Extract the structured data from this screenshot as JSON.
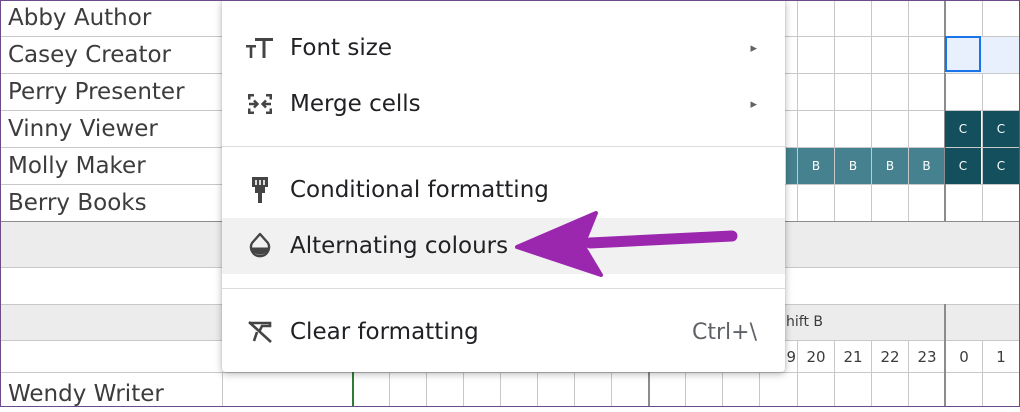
{
  "sheet": {
    "names": [
      "Abby Author",
      "Casey Creator",
      "Perry Presenter",
      "Vinny Viewer",
      "Molly Maker",
      "Berry Books"
    ],
    "bottom_name": "Wendy Writer",
    "shift_label": "hift B",
    "hours": [
      "9",
      "20",
      "21",
      "22",
      "23",
      "0",
      "1"
    ],
    "shift_codes": {
      "b": "B",
      "c": "C"
    },
    "colors": {
      "shift_b": "#45818e",
      "shift_c": "#134f5c",
      "selection": "#1a73e8"
    }
  },
  "menu": {
    "items": [
      {
        "label": "Font size",
        "icon": "font-size-icon",
        "submenu": "▸"
      },
      {
        "label": "Merge cells",
        "icon": "merge-cells-icon",
        "submenu": "▸"
      },
      {
        "label": "Conditional formatting",
        "icon": "paint-roller-icon"
      },
      {
        "label": "Alternating colours",
        "icon": "droplet-icon"
      },
      {
        "label": "Clear formatting",
        "icon": "clear-formatting-icon",
        "shortcut": "Ctrl+\\"
      }
    ]
  },
  "annotation": {
    "color": "#9b27af",
    "points_to": "Alternating colours"
  }
}
